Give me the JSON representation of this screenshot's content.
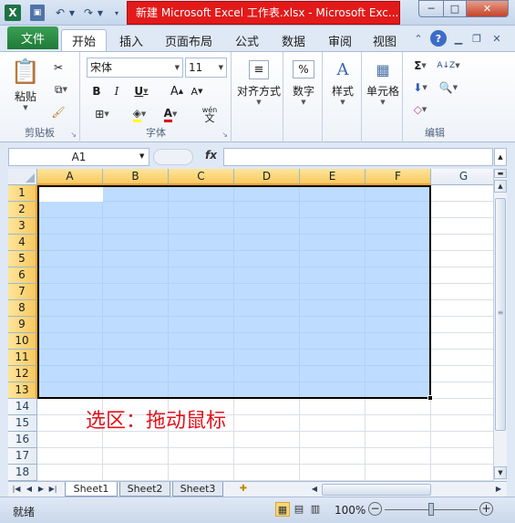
{
  "titlebar": {
    "app_icon": "X",
    "title": "新建 Microsoft Excel 工作表.xlsx - Microsoft Exc...",
    "min_glyph": "─",
    "max_glyph": "□",
    "close_glyph": "✕"
  },
  "tabs": {
    "file": "文件",
    "items": [
      "开始",
      "插入",
      "页面布局",
      "公式",
      "数据",
      "审阅",
      "视图"
    ]
  },
  "ribbon": {
    "clipboard": {
      "paste": "粘贴",
      "label": "剪贴板"
    },
    "font": {
      "name": "宋体",
      "size": "11",
      "label": "字体",
      "wen_glyph": "wén",
      "wen_char": "文"
    },
    "alignment": {
      "label": "对齐方式"
    },
    "number": {
      "label": "数字",
      "percent_glyph": "%"
    },
    "styles": {
      "label": "样式"
    },
    "cells": {
      "label": "单元格"
    },
    "editing": {
      "label": "编辑",
      "sum_glyph": "Σ",
      "sort_glyph": "A↓Z"
    }
  },
  "formula_bar": {
    "name_box": "A1",
    "fx": "fx",
    "value": ""
  },
  "grid": {
    "columns": [
      "A",
      "B",
      "C",
      "D",
      "E",
      "F",
      "G"
    ],
    "rows": [
      "1",
      "2",
      "3",
      "4",
      "5",
      "6",
      "7",
      "8",
      "9",
      "10",
      "11",
      "12",
      "13",
      "14",
      "15",
      "16",
      "17",
      "18"
    ],
    "selection": "A1:F13",
    "annotation": "选区：拖动鼠标"
  },
  "sheets": {
    "tabs": [
      "Sheet1",
      "Sheet2",
      "Sheet3"
    ],
    "active": "Sheet1"
  },
  "statusbar": {
    "status": "就绪",
    "zoom": "100%"
  },
  "colors": {
    "file_tab": "#1f7a37",
    "title_highlight": "#e21a1a",
    "selection": "#99c9ff",
    "annotation": "#e3121a",
    "header_selected": "#f9c960"
  }
}
